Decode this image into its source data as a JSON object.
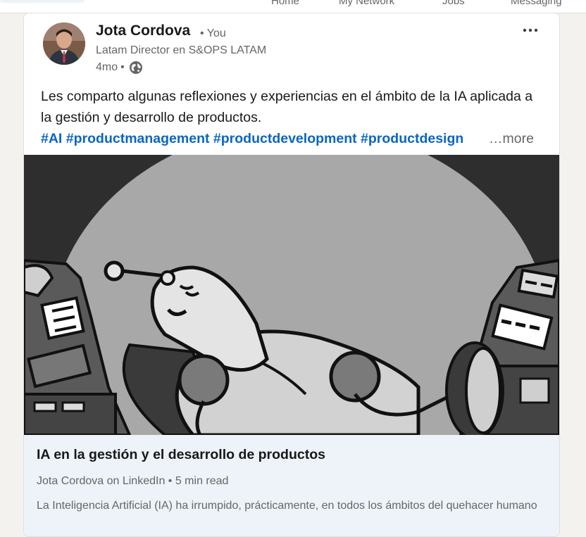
{
  "top_nav": {
    "items": [
      "Home",
      "My Network",
      "Jobs",
      "Messaging"
    ]
  },
  "post": {
    "author": {
      "name": "Jota Cordova",
      "relation": "• You",
      "headline": "Latam Director en S&OPS LATAM"
    },
    "time": "4mo",
    "time_separator": "•",
    "visibility_icon": "globe-icon",
    "menu_icon": "more-horizontal-icon",
    "text": "Les comparto algunas reflexiones y experiencias en el ámbito de la IA aplicada a la gestión y desarrollo de productos.",
    "hashtags": [
      "#AI",
      "#productmanagement",
      "#productdevelopment",
      "#productdesign"
    ],
    "see_more": "…more",
    "article": {
      "image_description_icon": "sleeping-robot-illustration",
      "title": "IA en la gestión y el desarrollo de productos",
      "source": "Jota Cordova on LinkedIn • 5 min read",
      "snippet": "La Inteligencia Artificial (IA) ha irrumpido, prácticamente, en todos los ámbitos del quehacer humano"
    }
  },
  "colors": {
    "link_blue": "#0a66c2",
    "meta_gray": "#666666",
    "page_bg": "#f4f2ee",
    "article_meta_bg": "#edf3f8"
  }
}
